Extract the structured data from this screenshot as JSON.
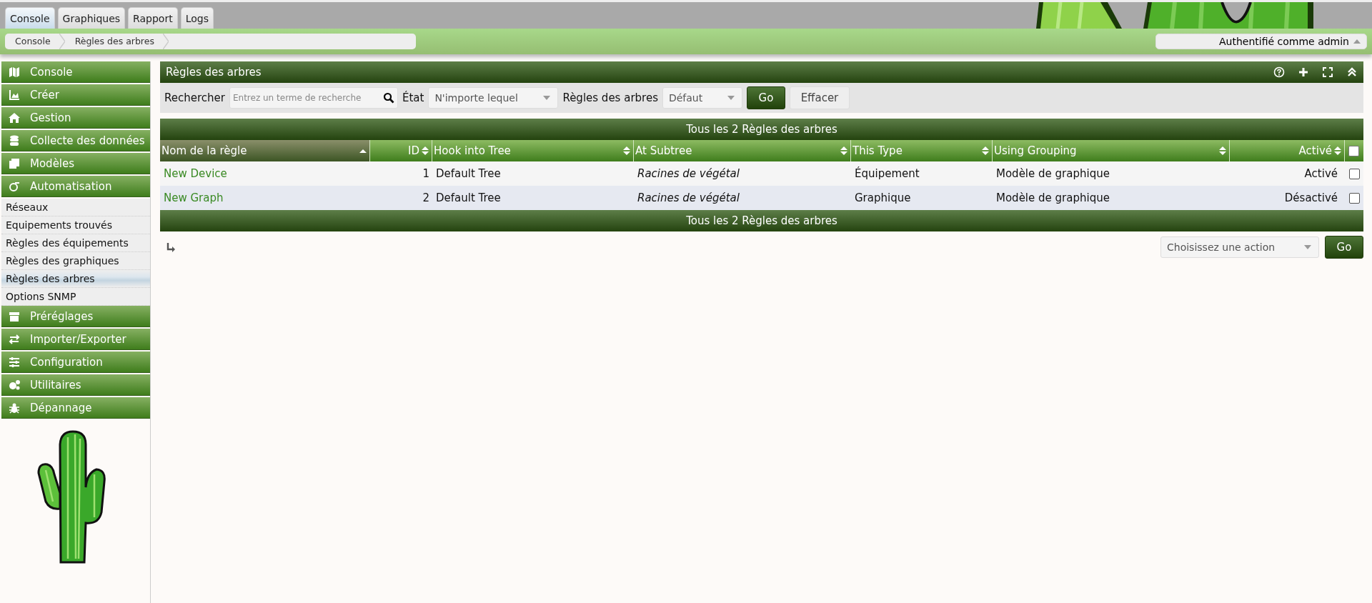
{
  "tabs": [
    {
      "label": "Console",
      "selected": true
    },
    {
      "label": "Graphiques",
      "selected": false
    },
    {
      "label": "Rapport",
      "selected": false
    },
    {
      "label": "Logs",
      "selected": false
    }
  ],
  "breadcrumb": [
    "Console",
    "Règles des arbres"
  ],
  "user_menu": {
    "label": "Authentifié comme admin"
  },
  "sidebar": {
    "items": [
      {
        "label": "Console"
      },
      {
        "label": "Créer"
      },
      {
        "label": "Gestion"
      },
      {
        "label": "Collecte des données"
      },
      {
        "label": "Modèles"
      },
      {
        "label": "Automatisation",
        "children": [
          {
            "label": "Réseaux",
            "selected": false
          },
          {
            "label": "Equipements trouvés",
            "selected": false
          },
          {
            "label": "Règles des équipements",
            "selected": false
          },
          {
            "label": "Règles des graphiques",
            "selected": false
          },
          {
            "label": "Règles des arbres",
            "selected": true
          },
          {
            "label": "Options SNMP",
            "selected": false
          }
        ]
      },
      {
        "label": "Préréglages"
      },
      {
        "label": "Importer/Exporter"
      },
      {
        "label": "Configuration"
      },
      {
        "label": "Utilitaires"
      },
      {
        "label": "Dépannage"
      }
    ]
  },
  "panel": {
    "title": "Règles des arbres"
  },
  "filters": {
    "search_label": "Rechercher",
    "search": {
      "placeholder": "Entrez un terme de recherche"
    },
    "state_label": "État",
    "state": {
      "value": "N'importe lequel"
    },
    "rules_label": "Règles des arbres",
    "rules": {
      "value": "Défaut"
    },
    "buttons": [
      "Go",
      "Effacer"
    ]
  },
  "table": {
    "caption_top": "Tous les 2 Règles des arbres",
    "caption_bottom": "Tous les 2 Règles des arbres",
    "columns": [
      {
        "label": "Nom de la règle",
        "sorted": true
      },
      {
        "label": "ID",
        "sorted": false
      },
      {
        "label": "Hook into Tree",
        "sorted": false
      },
      {
        "label": "At Subtree",
        "sorted": false
      },
      {
        "label": "This Type",
        "sorted": false
      },
      {
        "label": "Using Grouping",
        "sorted": false
      },
      {
        "label": "Activé",
        "sorted": false
      }
    ],
    "select_all": {
      "checked": false
    },
    "rows": [
      {
        "cells": [
          "New Device",
          "1",
          "Default Tree",
          "Racines de végétal",
          "Équipement",
          "Modèle de graphique",
          "Activé"
        ],
        "checked": false
      },
      {
        "cells": [
          "New Graph",
          "2",
          "Default Tree",
          "Racines de végétal",
          "Graphique",
          "Modèle de graphique",
          "Désactivé"
        ],
        "checked": false
      }
    ]
  },
  "actions": {
    "select": {
      "value": "Choisissez une action"
    },
    "button": "Go"
  }
}
